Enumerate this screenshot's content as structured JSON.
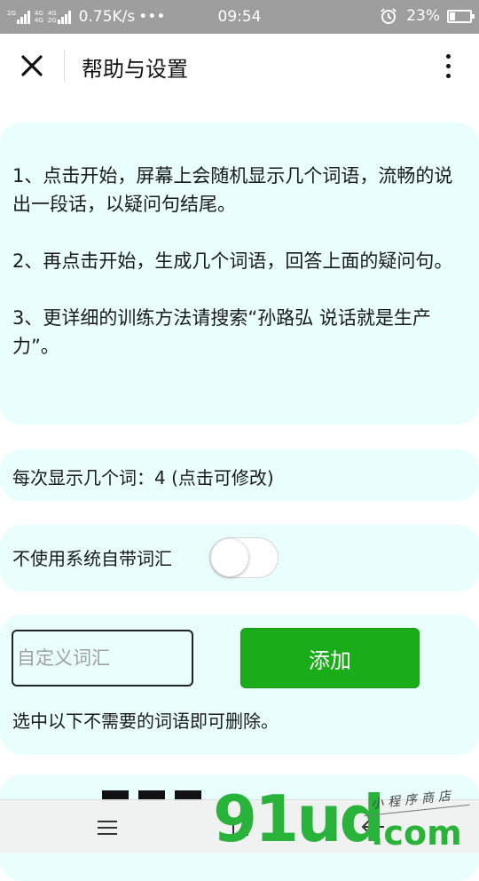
{
  "status_bar": {
    "signal1_label": "2G",
    "signal2_label_top": "4G",
    "signal2_label_bottom": "4G",
    "signal3_label_top": "4G",
    "signal3_label_bottom": "2G",
    "network_speed": "0.75K/s",
    "more_dots": "•••",
    "time": "09:54",
    "battery": "23%"
  },
  "nav": {
    "title": "帮助与设置"
  },
  "instructions": {
    "item1": "1、点击开始，屏幕上会随机显示几个词语，流畅的说出一段话，以疑问句结尾。",
    "item2": "2、再点击开始，生成几个词语，回答上面的疑问句。",
    "item3": "3、更详细的训练方法请搜索“孙路弘 说话就是生产力”。"
  },
  "settings": {
    "words_per_display": "每次显示几个词：4 (点击可修改)",
    "disable_system_vocab_label": "不使用系统自带词汇",
    "disable_system_vocab_on": false
  },
  "custom": {
    "input_placeholder": "自定义词汇",
    "add_button": "添加",
    "delete_hint": "选中以下不需要的词语即可删除。"
  },
  "watermark": {
    "logo": "91ud",
    "suffix": ".com",
    "tagline": "小程序商店"
  },
  "colors": {
    "status_bar_bg": "#9e9e9e",
    "card_bg": "#e9fffe",
    "accent_green": "#1aad19"
  }
}
